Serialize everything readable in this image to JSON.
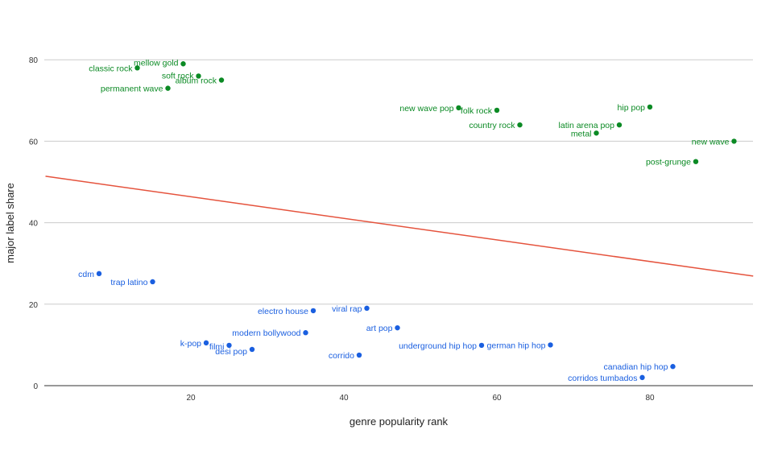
{
  "chart_data": {
    "type": "scatter",
    "title": "",
    "xlabel": "genre popularity rank",
    "ylabel": "major label share",
    "xlim": [
      1,
      93.5
    ],
    "ylim": [
      0,
      80
    ],
    "xticks": [
      20,
      40,
      60,
      80
    ],
    "yticks": [
      0,
      20,
      40,
      60,
      80
    ],
    "grid": true,
    "legend": "none",
    "colors": {
      "green": "#0b8a24",
      "blue": "#1a5fe0",
      "trend": "#e5533d",
      "grid": "#cccccc"
    },
    "series": [
      {
        "color": "green",
        "points": [
          {
            "label": "mellow gold",
            "x": 19,
            "y": 79
          },
          {
            "label": "classic rock",
            "x": 13,
            "y": 78
          },
          {
            "label": "soft rock",
            "x": 21,
            "y": 76
          },
          {
            "label": "album rock",
            "x": 24,
            "y": 75
          },
          {
            "label": "permanent wave",
            "x": 17,
            "y": 73
          },
          {
            "label": "new wave pop",
            "x": 55,
            "y": 68.2
          },
          {
            "label": "folk rock",
            "x": 60,
            "y": 67.6
          },
          {
            "label": "country rock",
            "x": 63,
            "y": 64
          },
          {
            "label": "hip pop",
            "x": 80,
            "y": 68.4
          },
          {
            "label": "latin arena pop",
            "x": 76,
            "y": 64
          },
          {
            "label": "metal",
            "x": 73,
            "y": 62
          },
          {
            "label": "new wave",
            "x": 91,
            "y": 60
          },
          {
            "label": "post-grunge",
            "x": 86,
            "y": 55
          }
        ]
      },
      {
        "color": "blue",
        "points": [
          {
            "label": "cdm",
            "x": 8,
            "y": 27.5
          },
          {
            "label": "trap latino",
            "x": 15,
            "y": 25.5
          },
          {
            "label": "electro house",
            "x": 36,
            "y": 18.4
          },
          {
            "label": "viral rap",
            "x": 43,
            "y": 19
          },
          {
            "label": "art pop",
            "x": 47,
            "y": 14.2
          },
          {
            "label": "modern bollywood",
            "x": 35,
            "y": 13
          },
          {
            "label": "k-pop",
            "x": 22,
            "y": 10.5
          },
          {
            "label": "filmi",
            "x": 25,
            "y": 9.9
          },
          {
            "label": "desi pop",
            "x": 28,
            "y": 8.9
          },
          {
            "label": "corrido",
            "x": 42,
            "y": 7.5
          },
          {
            "label": "underground hip hop",
            "x": 58,
            "y": 9.9
          },
          {
            "label": "german hip hop",
            "x": 67,
            "y": 10
          },
          {
            "label": "canadian hip hop",
            "x": 83,
            "y": 4.7
          },
          {
            "label": "corridos tumbados",
            "x": 79,
            "y": 2
          }
        ]
      }
    ],
    "trendline": {
      "type": "linear",
      "points": [
        {
          "x": 1,
          "y": 51.4
        },
        {
          "x": 93.5,
          "y": 26.9
        }
      ]
    }
  }
}
